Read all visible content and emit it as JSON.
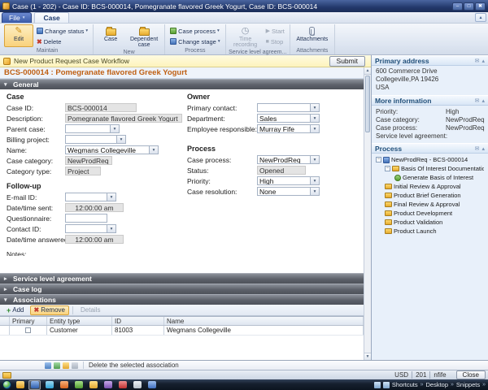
{
  "icons": {
    "dropdown": "▾",
    "section_open": "▾",
    "section_closed": "▸",
    "add": "+",
    "remove": "✖",
    "delete": "✖",
    "pencil": "✎",
    "mail": "✉",
    "collapse": "▴",
    "tree_minus": "−",
    "start": "▶",
    "stop": "■",
    "clock": "◷",
    "minimize": "–",
    "maximize": "□",
    "close": "✖",
    "scroll_up": "▲",
    "scroll_down": "▼",
    "chevron": "»"
  },
  "titlebar": {
    "title": "Case (1 - 202) - Case ID: BCS-000014, Pomegranate flavored Greek Yogurt, Case ID: BCS-000014"
  },
  "menubar": {
    "file": "File",
    "tab": "Case"
  },
  "ribbon": {
    "maintain": {
      "label": "Maintain",
      "edit": "Edit",
      "change_status": "Change status",
      "delete": "Delete"
    },
    "new_group": {
      "label": "New",
      "case": "Case",
      "dependent_case": "Dependent case"
    },
    "process": {
      "label": "Process",
      "case_process": "Case process",
      "change_stage": "Change stage"
    },
    "sla": {
      "label": "Service level agreem...",
      "time_recording": "Time recording",
      "start": "Start",
      "stop": "Stop"
    },
    "attachments": {
      "label": "Attachments",
      "attachments": "Attachments"
    }
  },
  "workflow": {
    "message": "New Product Request Case Workflow",
    "submit": "Submit"
  },
  "form": {
    "header": "BCS-000014 : Pomegranate flavored Greek Yogurt",
    "general": {
      "title": "General",
      "case": {
        "title": "Case",
        "case_id": {
          "label": "Case ID:",
          "value": "BCS-000014"
        },
        "description": {
          "label": "Description:",
          "value": "Pomegranate flavored Greek Yogurt"
        },
        "parent_case": {
          "label": "Parent case:",
          "value": ""
        },
        "billing_project": {
          "label": "Billing project:",
          "value": ""
        },
        "name": {
          "label": "Name:",
          "value": "Wegmans Collegeville"
        },
        "case_category": {
          "label": "Case category:",
          "value": "NewProdReq"
        },
        "category_type": {
          "label": "Category type:",
          "value": "Project"
        }
      },
      "owner": {
        "title": "Owner",
        "primary_contact": {
          "label": "Primary contact:",
          "value": ""
        },
        "department": {
          "label": "Department:",
          "value": "Sales"
        },
        "employee_responsible": {
          "label": "Employee responsible:",
          "value": "Murray Fife"
        }
      },
      "process": {
        "title": "Process",
        "case_process": {
          "label": "Case process:",
          "value": "NewProdReq"
        },
        "status": {
          "label": "Status:",
          "value": "Opened"
        },
        "priority": {
          "label": "Priority:",
          "value": "High"
        },
        "case_resolution": {
          "label": "Case resolution:",
          "value": "None"
        }
      },
      "followup": {
        "title": "Follow-up",
        "email_id": {
          "label": "E-mail ID:",
          "value": ""
        },
        "datetime_sent": {
          "label": "Date/time sent:",
          "value": "12:00:00 am"
        },
        "questionnaire": {
          "label": "Questionnaire:",
          "value": ""
        },
        "contact_id": {
          "label": "Contact ID:",
          "value": ""
        },
        "datetime_answered": {
          "label": "Date/time answered:",
          "value": "12:00:00 am"
        }
      },
      "notes_label": "Notes:"
    },
    "sla_section": "Service level agreement",
    "case_log_section": "Case log",
    "associations": {
      "title": "Associations",
      "toolbar": {
        "add": "Add",
        "remove": "Remove",
        "details": "Details"
      },
      "columns": [
        "Primary",
        "Entity type",
        "ID",
        "Name"
      ],
      "rows": [
        {
          "entity_type": "Customer",
          "id": "81003",
          "name": "Wegmans Collegeville"
        }
      ]
    }
  },
  "sidebar": {
    "primary_address": {
      "title": "Primary address",
      "lines": [
        "600 Commerce Drive",
        "Collegeville,PA 19426",
        "USA"
      ]
    },
    "more_information": {
      "title": "More information",
      "rows": [
        {
          "label": "Priority:",
          "value": "High"
        },
        {
          "label": "Case category:",
          "value": "NewProdReq"
        },
        {
          "label": "Case process:",
          "value": "NewProdReq"
        },
        {
          "label": "Service level agreement:",
          "value": ""
        }
      ]
    },
    "process": {
      "title": "Process",
      "root": "NewProdReq - BCS-000014",
      "items": [
        {
          "label": "Basis Of Interest Documentation"
        },
        {
          "label": "Generate Basis of Interest"
        },
        {
          "label": "Initial Review & Approval"
        },
        {
          "label": "Product Brief Generation"
        },
        {
          "label": "Final Review & Approval"
        },
        {
          "label": "Product Development"
        },
        {
          "label": "Product Validation"
        },
        {
          "label": "Product Launch"
        }
      ]
    }
  },
  "statusbar": {
    "hint": "Delete the selected association"
  },
  "appbar": {
    "currency": "USD",
    "company": "201",
    "user": "nfife",
    "close": "Close"
  },
  "taskbar": {
    "toolbars": [
      "Shortcuts",
      "Desktop",
      "Snippets"
    ]
  }
}
